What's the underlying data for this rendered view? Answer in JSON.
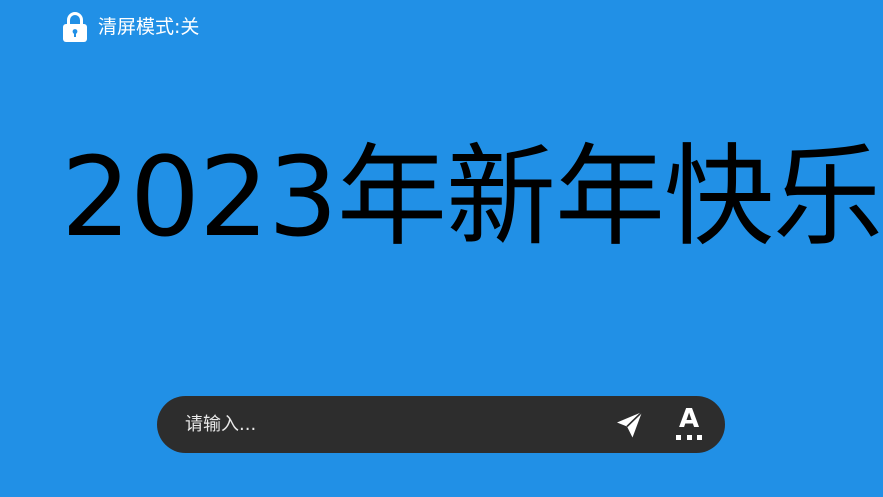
{
  "top_bar": {
    "lock_icon": "lock-icon",
    "clear_mode_label": "清屏模式:关"
  },
  "banner": {
    "text": "2023年新年快乐"
  },
  "input_bar": {
    "value": "",
    "placeholder": "请输入...",
    "send_icon": "send-icon",
    "font_icon": "font-style-icon",
    "font_icon_glyph": "A"
  },
  "colors": {
    "background": "#2190e6",
    "banner_text": "#000000",
    "input_bar_background": "#2d2d2d",
    "foreground": "#ffffff"
  }
}
